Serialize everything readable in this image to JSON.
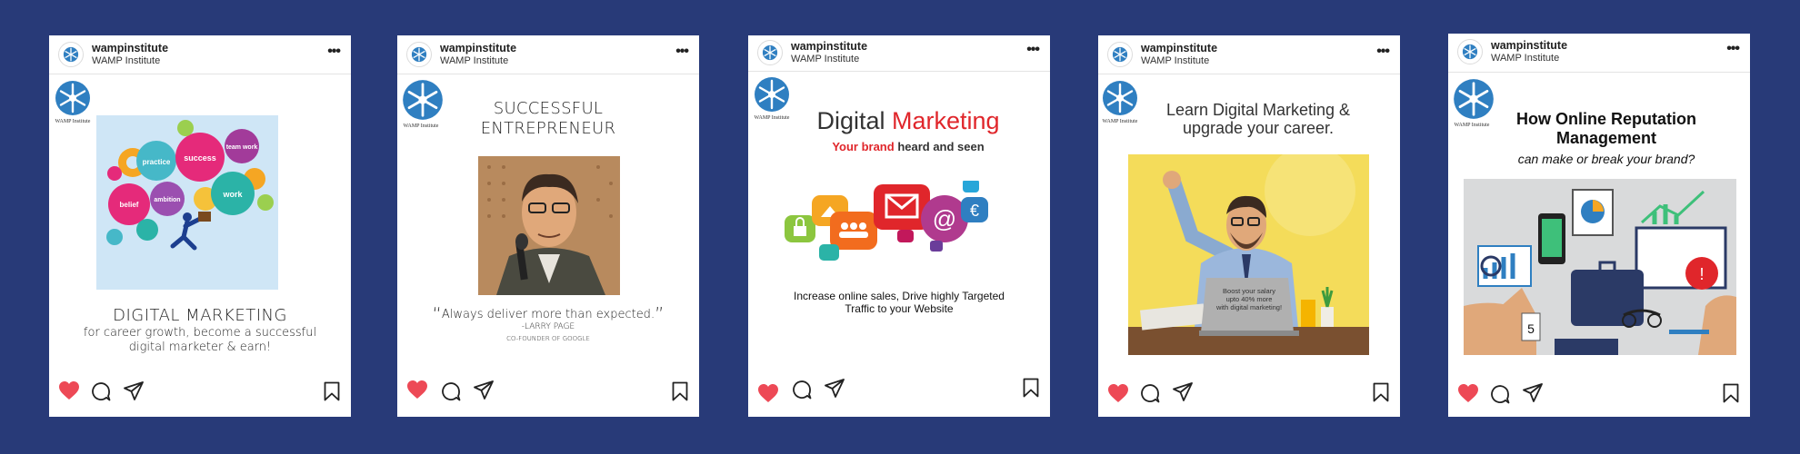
{
  "account": {
    "username": "wampinstitute",
    "full_name": "WAMP Institute",
    "logo_label": "WAMP Institute"
  },
  "posts": [
    {
      "headline": "DIGITAL MARKETING",
      "body_line1": "for career growth, become a successful",
      "body_line2": "digital marketer & earn!",
      "gears": [
        "practice",
        "success",
        "team work",
        "belief",
        "ambition",
        "work"
      ]
    },
    {
      "headline_line1": "SUCCESSFUL",
      "headline_line2": "ENTREPRENEUR",
      "quote": "Always deliver more than expected.",
      "author": "-LARRY PAGE",
      "author_title": "CO-FOUNDER OF GOOGLE"
    },
    {
      "title_part1": "Digital",
      "title_part2": "Marketing",
      "tagline_part1": "Your brand",
      "tagline_part2": "heard and seen",
      "body_line1": "Increase online sales, Drive highly Targeted",
      "body_line2": "Traffic to your Website"
    },
    {
      "headline_line1": "Learn Digital Marketing &",
      "headline_line2": "upgrade your career.",
      "laptop_text_line1": "Boost your salary",
      "laptop_text_line2": "upto 40% more",
      "laptop_text_line3": "with digital marketing!"
    },
    {
      "headline_line1": "How Online Reputation",
      "headline_line2": "Management",
      "subtitle": "can make or break your brand?"
    }
  ],
  "icons": {
    "like": "heart-icon",
    "comment": "comment-icon",
    "share": "send-icon",
    "save": "bookmark-icon",
    "more": "more-options-icon"
  },
  "colors": {
    "background": "#283a78",
    "like": "#ed4956",
    "brand_red": "#e0262b",
    "logo_blue": "#2f7fc1"
  }
}
